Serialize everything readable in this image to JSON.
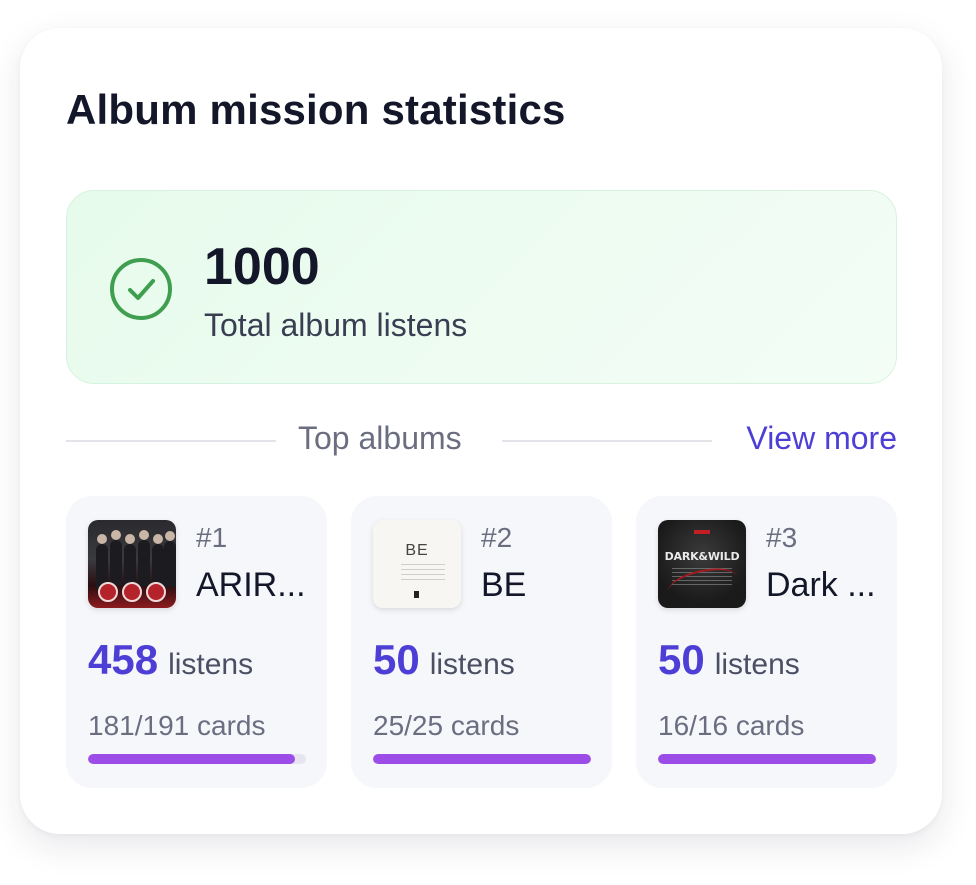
{
  "widget": {
    "title": "Album mission statistics"
  },
  "total": {
    "value": "1000",
    "label": "Total album listens",
    "icon": "check-circle-icon"
  },
  "top_albums": {
    "section_label": "Top albums",
    "view_more_label": "View more",
    "albums": [
      {
        "rank": "#1",
        "name": "ARIR...",
        "listens": "458",
        "listens_unit": "listens",
        "cards": "181/191 cards",
        "progress": 0.948,
        "cover_icon": "arirang-cover"
      },
      {
        "rank": "#2",
        "name": "BE",
        "listens": "50",
        "listens_unit": "listens",
        "cards": "25/25 cards",
        "progress": 1.0,
        "cover_icon": "be-cover",
        "cover_text": "BE"
      },
      {
        "rank": "#3",
        "name": "Dark ...",
        "listens": "50",
        "listens_unit": "listens",
        "cards": "16/16 cards",
        "progress": 1.0,
        "cover_icon": "dark-and-wild-cover",
        "cover_text": "DARK&WILD"
      }
    ]
  },
  "colors": {
    "accent": "#4d3fd6",
    "progress": "#9c4de8",
    "success": "#3f9e4f",
    "success_bg": "#e6fbeb"
  }
}
